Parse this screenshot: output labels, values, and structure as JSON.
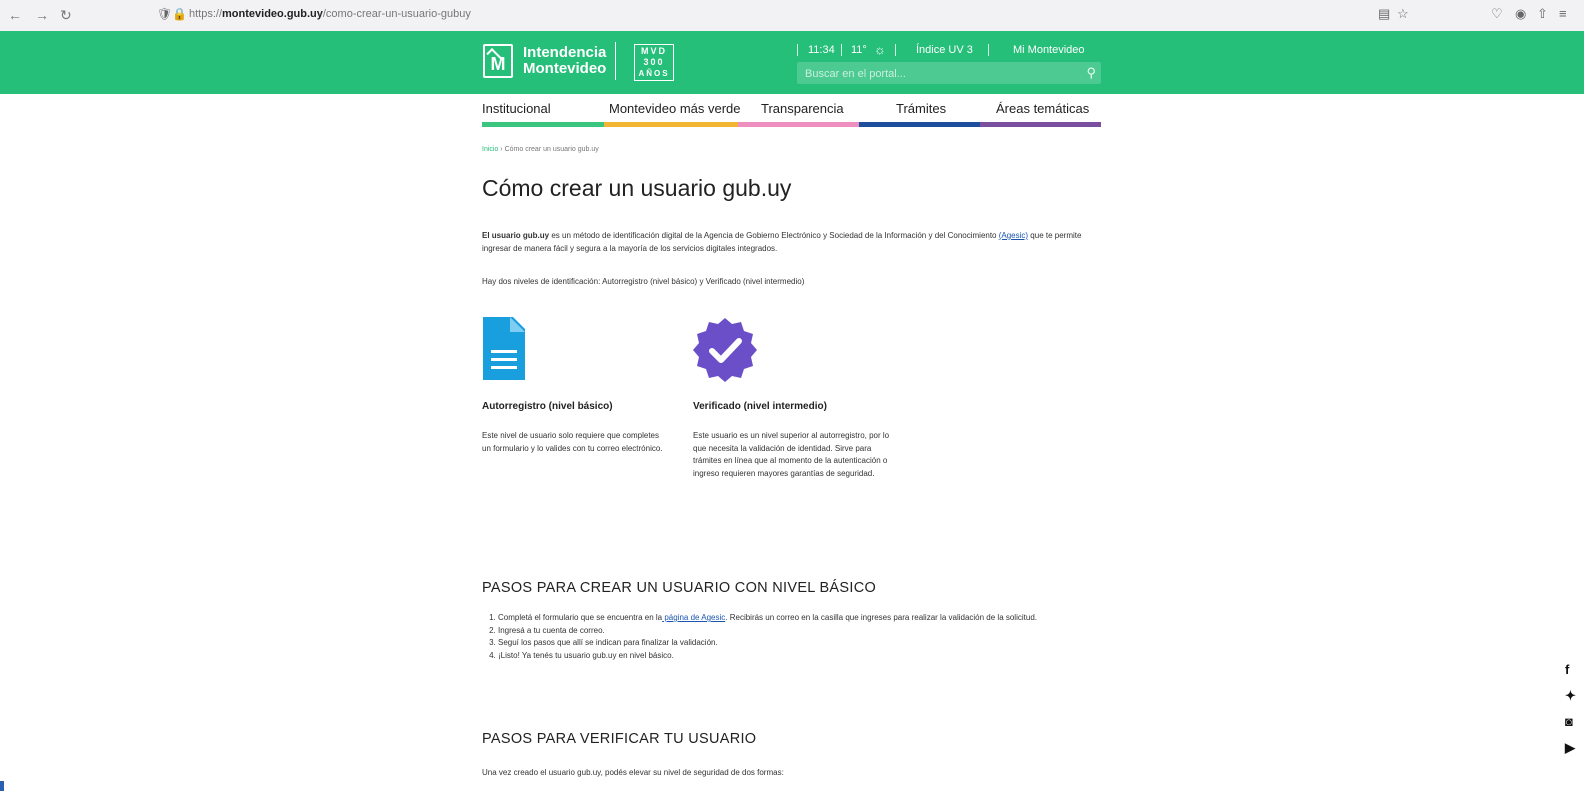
{
  "browser": {
    "url_prefix": "https://",
    "url_domain": "montevideo.gub.uy",
    "url_path": "/como-crear-un-usuario-gubuy",
    "back_icon": "back-arrow-icon",
    "forward_icon": "forward-arrow-icon",
    "reload_icon": "reload-icon"
  },
  "header": {
    "logo_line1": "Intendencia",
    "logo_line2": "Montevideo",
    "logo_letter": "M",
    "mvd_line1": "MVD",
    "mvd_line2": "300",
    "mvd_line3": "AÑOS",
    "time": "11:34",
    "temperature": "11°",
    "uv_label": "Índice UV 3",
    "account_link": "Mi Montevideo",
    "search_placeholder": "Buscar en el portal..."
  },
  "nav": {
    "items": [
      {
        "label": "Institucional",
        "color": "#3cc57f"
      },
      {
        "label": "Montevideo más verde",
        "color": "#f2b534"
      },
      {
        "label": "Transparencia",
        "color": "#ef8fbf"
      },
      {
        "label": "Trámites",
        "color": "#1d4f9c"
      },
      {
        "label": "Áreas temáticas",
        "color": "#7b4fa0"
      }
    ]
  },
  "breadcrumb": {
    "home": "Inicio",
    "separator": "›",
    "current": "Cómo crear un usuario gub.uy"
  },
  "page": {
    "title": "Cómo crear un usuario gub.uy",
    "intro_bold": "El usuario gub.uy",
    "intro_text1": " es un método de identificación digital de la Agencia de Gobierno Electrónico y Sociedad de la Información y del Conocimiento ",
    "intro_link": "(Agesic)",
    "intro_text2": " que te permite ingresar de manera fácil y segura a la mayoría de los servicios digitales integrados.",
    "levels_text": "Hay dos niveles de identificación: Autorregistro (nivel básico) y Verificado (nivel intermedio)"
  },
  "cards": [
    {
      "icon": "document-icon",
      "title": "Autorregistro (nivel básico)",
      "text": "Este nivel de usuario solo requiere que completes un formulario y lo valides con tu correo electrónico."
    },
    {
      "icon": "verified-badge-icon",
      "title": "Verificado (nivel intermedio)",
      "text": "Este usuario es un nivel superior al autorregistro, por lo que necesita la validación de identidad. Sirve para trámites en línea que al momento de la autenticación o ingreso requieren mayores garantías de seguridad."
    }
  ],
  "basic_steps": {
    "heading": "PASOS PARA CREAR UN USUARIO CON NIVEL BÁSICO",
    "step1_before": "Completá el formulario que se encuentra en la",
    "step1_link": " página de Agesic",
    "step1_after": ". Recibirás un correo en la casilla que ingreses para realizar la validación de la solicitud.",
    "step2": "Ingresá a tu cuenta de correo.",
    "step3": "Seguí los pasos que allí se indican para finalizar la validación.",
    "step4": "¡Listo! Ya tenés tu usuario gub.uy en nivel básico."
  },
  "verify_steps": {
    "heading": "PASOS PARA VERIFICAR TU USUARIO",
    "intro": "Una vez creado el usuario gub.uy, podés elevar su nivel de seguridad de dos formas:"
  },
  "colors": {
    "brand_green": "#25bf7a",
    "doc_blue": "#1a9fde",
    "badge_purple": "#6b4fc9",
    "link_blue": "#1a56b0"
  }
}
